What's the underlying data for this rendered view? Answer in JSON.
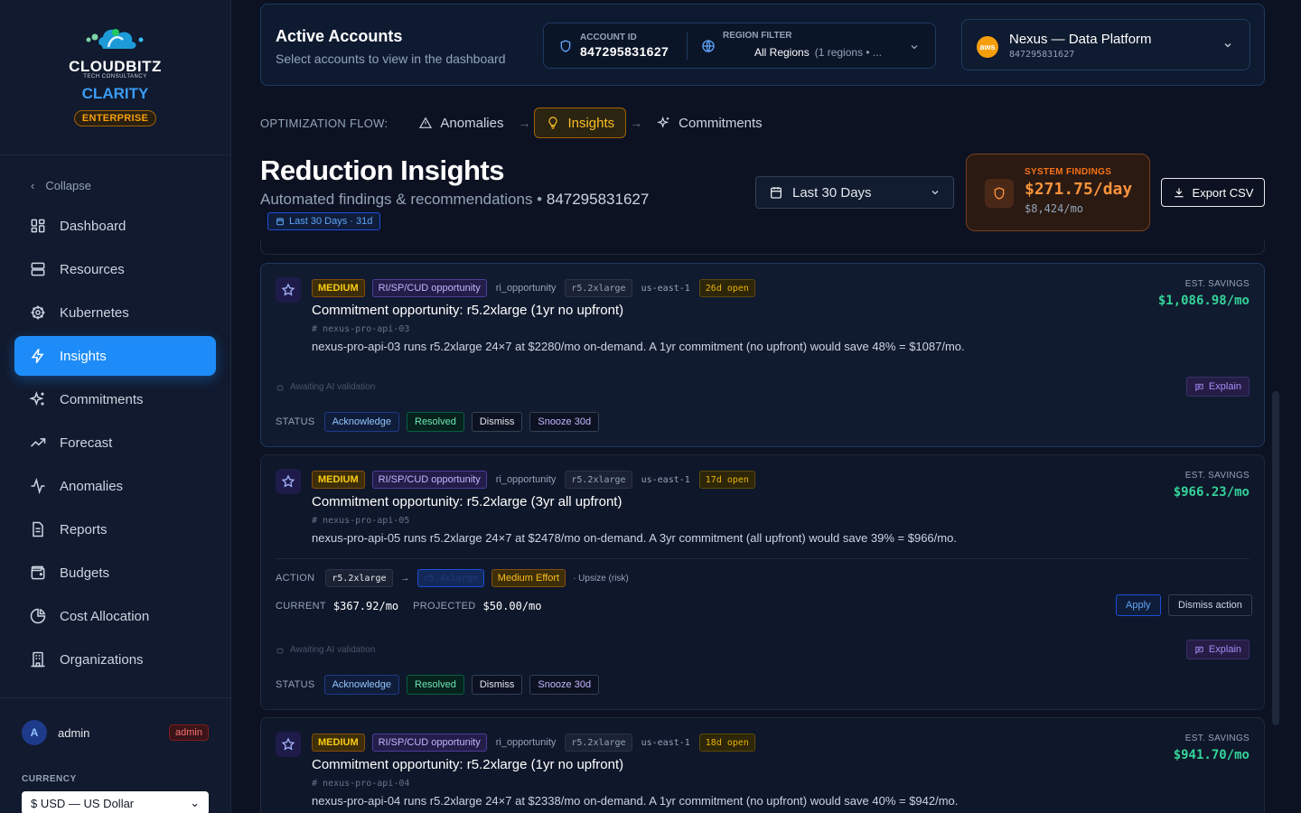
{
  "brand": {
    "name": "CLOUDBITZ",
    "sub": "TECH CONSULTANCY",
    "product": "CLARITY",
    "tier": "ENTERPRISE"
  },
  "nav": {
    "collapse": "Collapse",
    "items": [
      {
        "label": "Dashboard",
        "icon": "grid-icon"
      },
      {
        "label": "Resources",
        "icon": "server-icon"
      },
      {
        "label": "Kubernetes",
        "icon": "helm-icon"
      },
      {
        "label": "Insights",
        "icon": "bolt-icon",
        "active": true
      },
      {
        "label": "Commitments",
        "icon": "sparkles-icon"
      },
      {
        "label": "Forecast",
        "icon": "trend-icon"
      },
      {
        "label": "Anomalies",
        "icon": "pulse-icon"
      },
      {
        "label": "Reports",
        "icon": "document-icon"
      },
      {
        "label": "Budgets",
        "icon": "wallet-icon"
      },
      {
        "label": "Cost Allocation",
        "icon": "pie-icon"
      },
      {
        "label": "Organizations",
        "icon": "building-icon"
      }
    ]
  },
  "user": {
    "initial": "A",
    "name": "admin",
    "role": "admin"
  },
  "currency": {
    "label": "CURRENCY",
    "value": "$ USD — US Dollar"
  },
  "topbar": {
    "title": "Active Accounts",
    "subtitle": "Select accounts to view in the dashboard",
    "account_label": "ACCOUNT ID",
    "account_id": "847295831627",
    "region_label": "REGION FILTER",
    "region_value": "All Regions",
    "region_count": "(1 regions • ...",
    "platform_logo": "aws",
    "platform_name": "Nexus — Data Platform",
    "platform_id": "847295831627"
  },
  "flow": {
    "label": "OPTIMIZATION FLOW:",
    "steps": [
      "Anomalies",
      "Insights",
      "Commitments"
    ]
  },
  "page": {
    "title": "Reduction Insights",
    "subtitle": "Automated findings & recommendations •",
    "subtitle_id": "847295831627",
    "range_chip": "Last 30 Days · 31d",
    "date_select": "Last 30 Days",
    "findings_label": "SYSTEM FINDINGS",
    "findings_value": "$271.75/day",
    "findings_sub": "$8,424/mo",
    "export": "Export CSV"
  },
  "common": {
    "savings_label": "EST. SAVINGS",
    "ai_note": "Awaiting AI validation",
    "explain": "Explain",
    "status_label": "STATUS",
    "status_buttons": [
      "Acknowledge",
      "Resolved",
      "Dismiss",
      "Snooze 30d"
    ]
  },
  "cards": [
    {
      "severity": "MEDIUM",
      "type": "RI/SP/CUD opportunity",
      "category": "ri_opportunity",
      "instance": "r5.2xlarge",
      "region": "us-east-1",
      "age": "26d open",
      "title": "Commitment opportunity: r5.2xlarge (1yr no upfront)",
      "resource": "nexus-pro-api-03",
      "description": "nexus-pro-api-03 runs r5.2xlarge 24×7 at $2280/mo on-demand. A 1yr commitment (no upfront) would save 48% = $1087/mo.",
      "savings": "$1,086.98/mo"
    },
    {
      "severity": "MEDIUM",
      "type": "RI/SP/CUD opportunity",
      "category": "ri_opportunity",
      "instance": "r5.2xlarge",
      "region": "us-east-1",
      "age": "17d open",
      "title": "Commitment opportunity: r5.2xlarge (3yr all upfront)",
      "resource": "nexus-pro-api-05",
      "description": "nexus-pro-api-05 runs r5.2xlarge 24×7 at $2478/mo on-demand. A 3yr commitment (all upfront) would save 39% = $966/mo.",
      "savings": "$966.23/mo",
      "action": {
        "label": "ACTION",
        "from": "r5.2xlarge",
        "to": "r5.4xlarge",
        "effort": "Medium Effort",
        "note": "· Upsize (risk)",
        "current_label": "CURRENT",
        "current": "$367.92/mo",
        "projected_label": "PROJECTED",
        "projected": "$50.00/mo",
        "apply": "Apply",
        "dismiss": "Dismiss action"
      }
    },
    {
      "severity": "MEDIUM",
      "type": "RI/SP/CUD opportunity",
      "category": "ri_opportunity",
      "instance": "r5.2xlarge",
      "region": "us-east-1",
      "age": "18d open",
      "title": "Commitment opportunity: r5.2xlarge (1yr no upfront)",
      "resource": "nexus-pro-api-04",
      "description": "nexus-pro-api-04 runs r5.2xlarge 24×7 at $2338/mo on-demand. A 1yr commitment (no upfront) would save 40% = $942/mo.",
      "savings": "$941.70/mo"
    }
  ]
}
